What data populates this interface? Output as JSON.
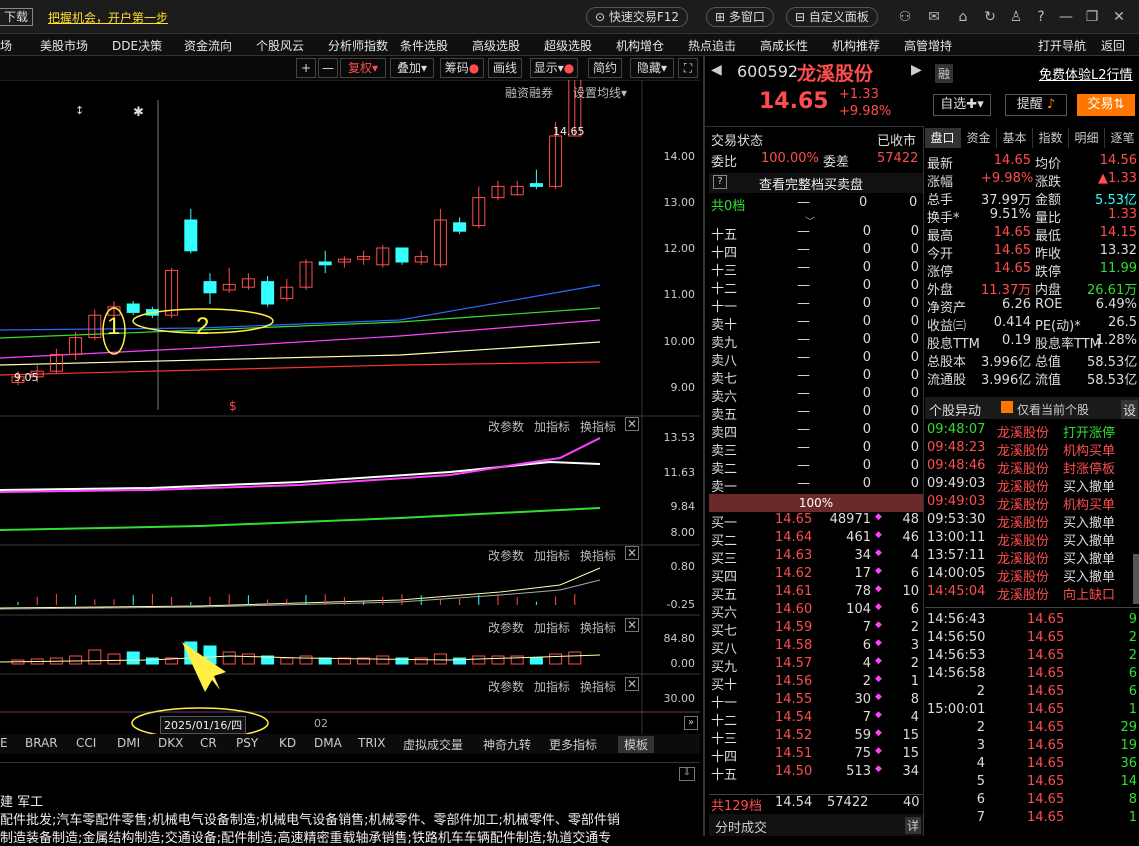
{
  "topbar": {
    "download": "下载",
    "promo": "把握机会，开户第一步",
    "quick_trade": "快速交易F12",
    "multi_window": "多窗口",
    "custom_panel": "自定义面板"
  },
  "menu": [
    "场",
    "美股市场",
    "DDE决策",
    "资金流向",
    "个股风云",
    "分析师指数",
    "条件选股",
    "高级选股",
    "超级选股",
    "机构增仓",
    "热点追击",
    "高成长性",
    "机构推荐",
    "高管增持"
  ],
  "menu_right": [
    "打开导航",
    "返回"
  ],
  "tools": {
    "restore": "复权",
    "overlay": "叠加",
    "chips": "筹码",
    "draw": "画线",
    "display": "显示",
    "simple": "简约",
    "hide": "隐藏",
    "margin": "融资融券",
    "ma_setting": "设置均线"
  },
  "chart_data": {
    "type": "candlestick",
    "ylim": [
      8.5,
      14.5
    ],
    "y_ticks": [
      "14.00",
      "13.00",
      "12.00",
      "11.00",
      "10.00",
      "9.00"
    ],
    "price_label": "14.65",
    "low_label": "9.05",
    "date_label": "2025/01/16/四",
    "date_label2": "02",
    "annotations": [
      "1",
      "2"
    ],
    "candles": [
      {
        "o": 9.1,
        "c": 9.2,
        "h": 9.3,
        "l": 9.05,
        "up": true
      },
      {
        "o": 9.2,
        "c": 9.3,
        "h": 9.4,
        "l": 9.1,
        "up": true
      },
      {
        "o": 9.3,
        "c": 9.6,
        "h": 9.7,
        "l": 9.25,
        "up": true
      },
      {
        "o": 9.6,
        "c": 9.9,
        "h": 10.0,
        "l": 9.5,
        "up": true
      },
      {
        "o": 9.9,
        "c": 10.3,
        "h": 10.4,
        "l": 9.85,
        "up": true
      },
      {
        "o": 10.3,
        "c": 10.45,
        "h": 10.55,
        "l": 10.2,
        "up": true
      },
      {
        "o": 10.5,
        "c": 10.35,
        "h": 10.55,
        "l": 10.3,
        "up": false
      },
      {
        "o": 10.4,
        "c": 10.3,
        "h": 10.45,
        "l": 10.25,
        "up": false
      },
      {
        "o": 10.3,
        "c": 11.1,
        "h": 11.15,
        "l": 10.25,
        "up": true
      },
      {
        "o": 12.0,
        "c": 11.45,
        "h": 12.2,
        "l": 11.4,
        "up": false
      },
      {
        "o": 10.9,
        "c": 10.7,
        "h": 11.05,
        "l": 10.5,
        "up": false
      },
      {
        "o": 10.75,
        "c": 10.85,
        "h": 11.15,
        "l": 10.7,
        "up": true
      },
      {
        "o": 10.8,
        "c": 10.95,
        "h": 11.05,
        "l": 10.75,
        "up": true
      },
      {
        "o": 10.9,
        "c": 10.5,
        "h": 11.0,
        "l": 10.45,
        "up": false
      },
      {
        "o": 10.6,
        "c": 10.8,
        "h": 10.95,
        "l": 10.55,
        "up": true
      },
      {
        "o": 10.8,
        "c": 11.25,
        "h": 11.3,
        "l": 10.75,
        "up": true
      },
      {
        "o": 11.2,
        "c": 11.25,
        "h": 11.45,
        "l": 11.05,
        "up": false
      },
      {
        "o": 11.25,
        "c": 11.3,
        "h": 11.35,
        "l": 11.15,
        "up": true
      },
      {
        "o": 11.3,
        "c": 11.35,
        "h": 11.45,
        "l": 11.2,
        "up": true
      },
      {
        "o": 11.2,
        "c": 11.5,
        "h": 11.55,
        "l": 11.15,
        "up": true
      },
      {
        "o": 11.5,
        "c": 11.25,
        "h": 11.5,
        "l": 11.2,
        "up": false
      },
      {
        "o": 11.25,
        "c": 11.35,
        "h": 11.45,
        "l": 11.2,
        "up": true
      },
      {
        "o": 11.2,
        "c": 12.0,
        "h": 12.2,
        "l": 11.15,
        "up": true
      },
      {
        "o": 11.95,
        "c": 11.8,
        "h": 12.05,
        "l": 11.75,
        "up": false
      },
      {
        "o": 11.9,
        "c": 12.4,
        "h": 12.6,
        "l": 11.85,
        "up": true
      },
      {
        "o": 12.4,
        "c": 12.6,
        "h": 12.7,
        "l": 12.35,
        "up": true
      },
      {
        "o": 12.45,
        "c": 12.6,
        "h": 12.7,
        "l": 12.45,
        "up": true
      },
      {
        "o": 12.65,
        "c": 12.6,
        "h": 12.9,
        "l": 12.55,
        "up": false
      },
      {
        "o": 12.6,
        "c": 13.5,
        "h": 13.75,
        "l": 12.55,
        "up": true
      },
      {
        "o": 13.5,
        "c": 14.65,
        "h": 14.65,
        "l": 13.5,
        "up": true
      }
    ]
  },
  "sub": {
    "change_param": "改参数",
    "add_ind": "加指标",
    "switch_ind": "换指标",
    "p2": [
      "13.53",
      "11.63",
      "9.84",
      "8.00"
    ],
    "p3": [
      "0.80",
      "-0.25"
    ],
    "p4": [
      "84.80",
      "0.00"
    ],
    "p5": [
      "30.00"
    ]
  },
  "ind_tabs": [
    "E",
    "BRAR",
    "CCI",
    "DMI",
    "DKX",
    "CR",
    "PSY",
    "KD",
    "DMA",
    "TRIX",
    "虚拟成交量",
    "神奇九转",
    "更多指标",
    "模板"
  ],
  "bottom": {
    "tag": "建  军工",
    "line1": "配件批发;汽车零配件零售;机械电气设备制造;机械电气设备销售;机械零件、零部件加工;机械零件、零部件销",
    "line2": "制造装备制造;金属结构制造;交通设备;配件制造;高速精密重载轴承销售;铁路机车车辆配件制造;轨道交通专"
  },
  "stock": {
    "code": "600592",
    "name": "龙溪股份",
    "rong": "融",
    "price": "14.65",
    "chg": "+1.33",
    "pct": "+9.98%",
    "free_l2": "免费体验L2行情",
    "watch": "自选",
    "remind": "提醒",
    "trade": "交易"
  },
  "status": {
    "label": "交易状态",
    "value": "已收市",
    "wb_label": "委比",
    "wb": "100.00%",
    "wc_label": "委差",
    "wc": "57422",
    "full": "查看完整档买卖盘",
    "share0": "共0档",
    "dash": "—",
    "zero": "0"
  },
  "sells": [
    "十五",
    "十四",
    "十三",
    "十二",
    "十一",
    "卖十",
    "卖九",
    "卖八",
    "卖七",
    "卖六",
    "卖五",
    "卖四",
    "卖三",
    "卖二",
    "卖一"
  ],
  "pct_bar": "100%",
  "buys": [
    {
      "n": "买一",
      "p": "14.65",
      "v": "48971",
      "k": "48"
    },
    {
      "n": "买二",
      "p": "14.64",
      "v": "461",
      "k": "46"
    },
    {
      "n": "买三",
      "p": "14.63",
      "v": "34",
      "k": "4"
    },
    {
      "n": "买四",
      "p": "14.62",
      "v": "17",
      "k": "6"
    },
    {
      "n": "买五",
      "p": "14.61",
      "v": "78",
      "k": "10"
    },
    {
      "n": "买六",
      "p": "14.60",
      "v": "104",
      "k": "6"
    },
    {
      "n": "买七",
      "p": "14.59",
      "v": "7",
      "k": "2"
    },
    {
      "n": "买八",
      "p": "14.58",
      "v": "6",
      "k": "3"
    },
    {
      "n": "买九",
      "p": "14.57",
      "v": "4",
      "k": "2"
    },
    {
      "n": "买十",
      "p": "14.56",
      "v": "2",
      "k": "1"
    },
    {
      "n": "十一",
      "p": "14.55",
      "v": "30",
      "k": "8"
    },
    {
      "n": "十二",
      "p": "14.54",
      "v": "7",
      "k": "4"
    },
    {
      "n": "十三",
      "p": "14.52",
      "v": "59",
      "k": "15"
    },
    {
      "n": "十四",
      "p": "14.51",
      "v": "75",
      "k": "15"
    },
    {
      "n": "十五",
      "p": "14.50",
      "v": "513",
      "k": "34"
    }
  ],
  "buy_total": {
    "n": "共129档",
    "p": "14.54",
    "v": "57422",
    "k": "40"
  },
  "tick_title": "分时成交",
  "tick_detail": "详",
  "tabs": [
    "盘口",
    "资金",
    "基本",
    "指数",
    "明细",
    "逐笔"
  ],
  "quote": [
    [
      "最新",
      "14.65",
      "r",
      "均价",
      "14.56",
      "r"
    ],
    [
      "涨幅",
      "+9.98%",
      "r",
      "涨跌",
      "▲1.33",
      "r"
    ],
    [
      "总手",
      "37.99万",
      "w",
      "金额",
      "5.53亿",
      "c"
    ],
    [
      "换手*",
      "9.51%",
      "w",
      "量比",
      "1.33",
      "r"
    ],
    [
      "最高",
      "14.65",
      "r",
      "最低",
      "14.15",
      "r"
    ],
    [
      "今开",
      "14.65",
      "r",
      "昨收",
      "13.32",
      "w"
    ],
    [
      "涨停",
      "14.65",
      "r",
      "跌停",
      "11.99",
      "g"
    ],
    [
      "外盘",
      "11.37万",
      "r",
      "内盘",
      "26.61万",
      "g"
    ],
    [
      "净资产",
      "6.26",
      "w",
      "ROE",
      "6.49%",
      "w"
    ],
    [
      "收益㈢",
      "0.414",
      "w",
      "PE(动)*",
      "26.5",
      "w"
    ],
    [
      "股息TTM",
      "0.19",
      "w",
      "股息率TTM",
      "1.28%",
      "w"
    ],
    [
      "总股本",
      "3.996亿",
      "w",
      "总值",
      "58.53亿",
      "w"
    ],
    [
      "流通股",
      "3.996亿",
      "w",
      "流值",
      "58.53亿",
      "w"
    ]
  ],
  "anomaly": {
    "title": "个股异动",
    "only": "仅看当前个股",
    "set": "设"
  },
  "events": [
    [
      "09:48:07",
      "龙溪股份",
      "打开涨停",
      "g"
    ],
    [
      "09:48:23",
      "龙溪股份",
      "机构买单",
      "r"
    ],
    [
      "09:48:46",
      "龙溪股份",
      "封涨停板",
      "r"
    ],
    [
      "09:49:03",
      "龙溪股份",
      "买入撤单",
      "w"
    ],
    [
      "09:49:03",
      "龙溪股份",
      "机构买单",
      "r"
    ],
    [
      "09:53:30",
      "龙溪股份",
      "买入撤单",
      "w"
    ],
    [
      "13:00:11",
      "龙溪股份",
      "买入撤单",
      "w"
    ],
    [
      "13:57:11",
      "龙溪股份",
      "买入撤单",
      "w"
    ],
    [
      "14:00:05",
      "龙溪股份",
      "买入撤单",
      "w"
    ],
    [
      "14:45:04",
      "龙溪股份",
      "向上缺口",
      "r"
    ]
  ],
  "ticks": [
    [
      "14:56:43",
      "14.65",
      "9"
    ],
    [
      "14:56:50",
      "14.65",
      "2"
    ],
    [
      "14:56:53",
      "14.65",
      "2"
    ],
    [
      "14:56:58",
      "14.65",
      "6"
    ],
    [
      "2",
      "14.65",
      "6"
    ],
    [
      "15:00:01",
      "14.65",
      "1"
    ],
    [
      "2",
      "14.65",
      "29"
    ],
    [
      "3",
      "14.65",
      "19"
    ],
    [
      "4",
      "14.65",
      "36"
    ],
    [
      "5",
      "14.65",
      "14"
    ],
    [
      "6",
      "14.65",
      "8"
    ],
    [
      "7",
      "14.65",
      "1"
    ]
  ]
}
